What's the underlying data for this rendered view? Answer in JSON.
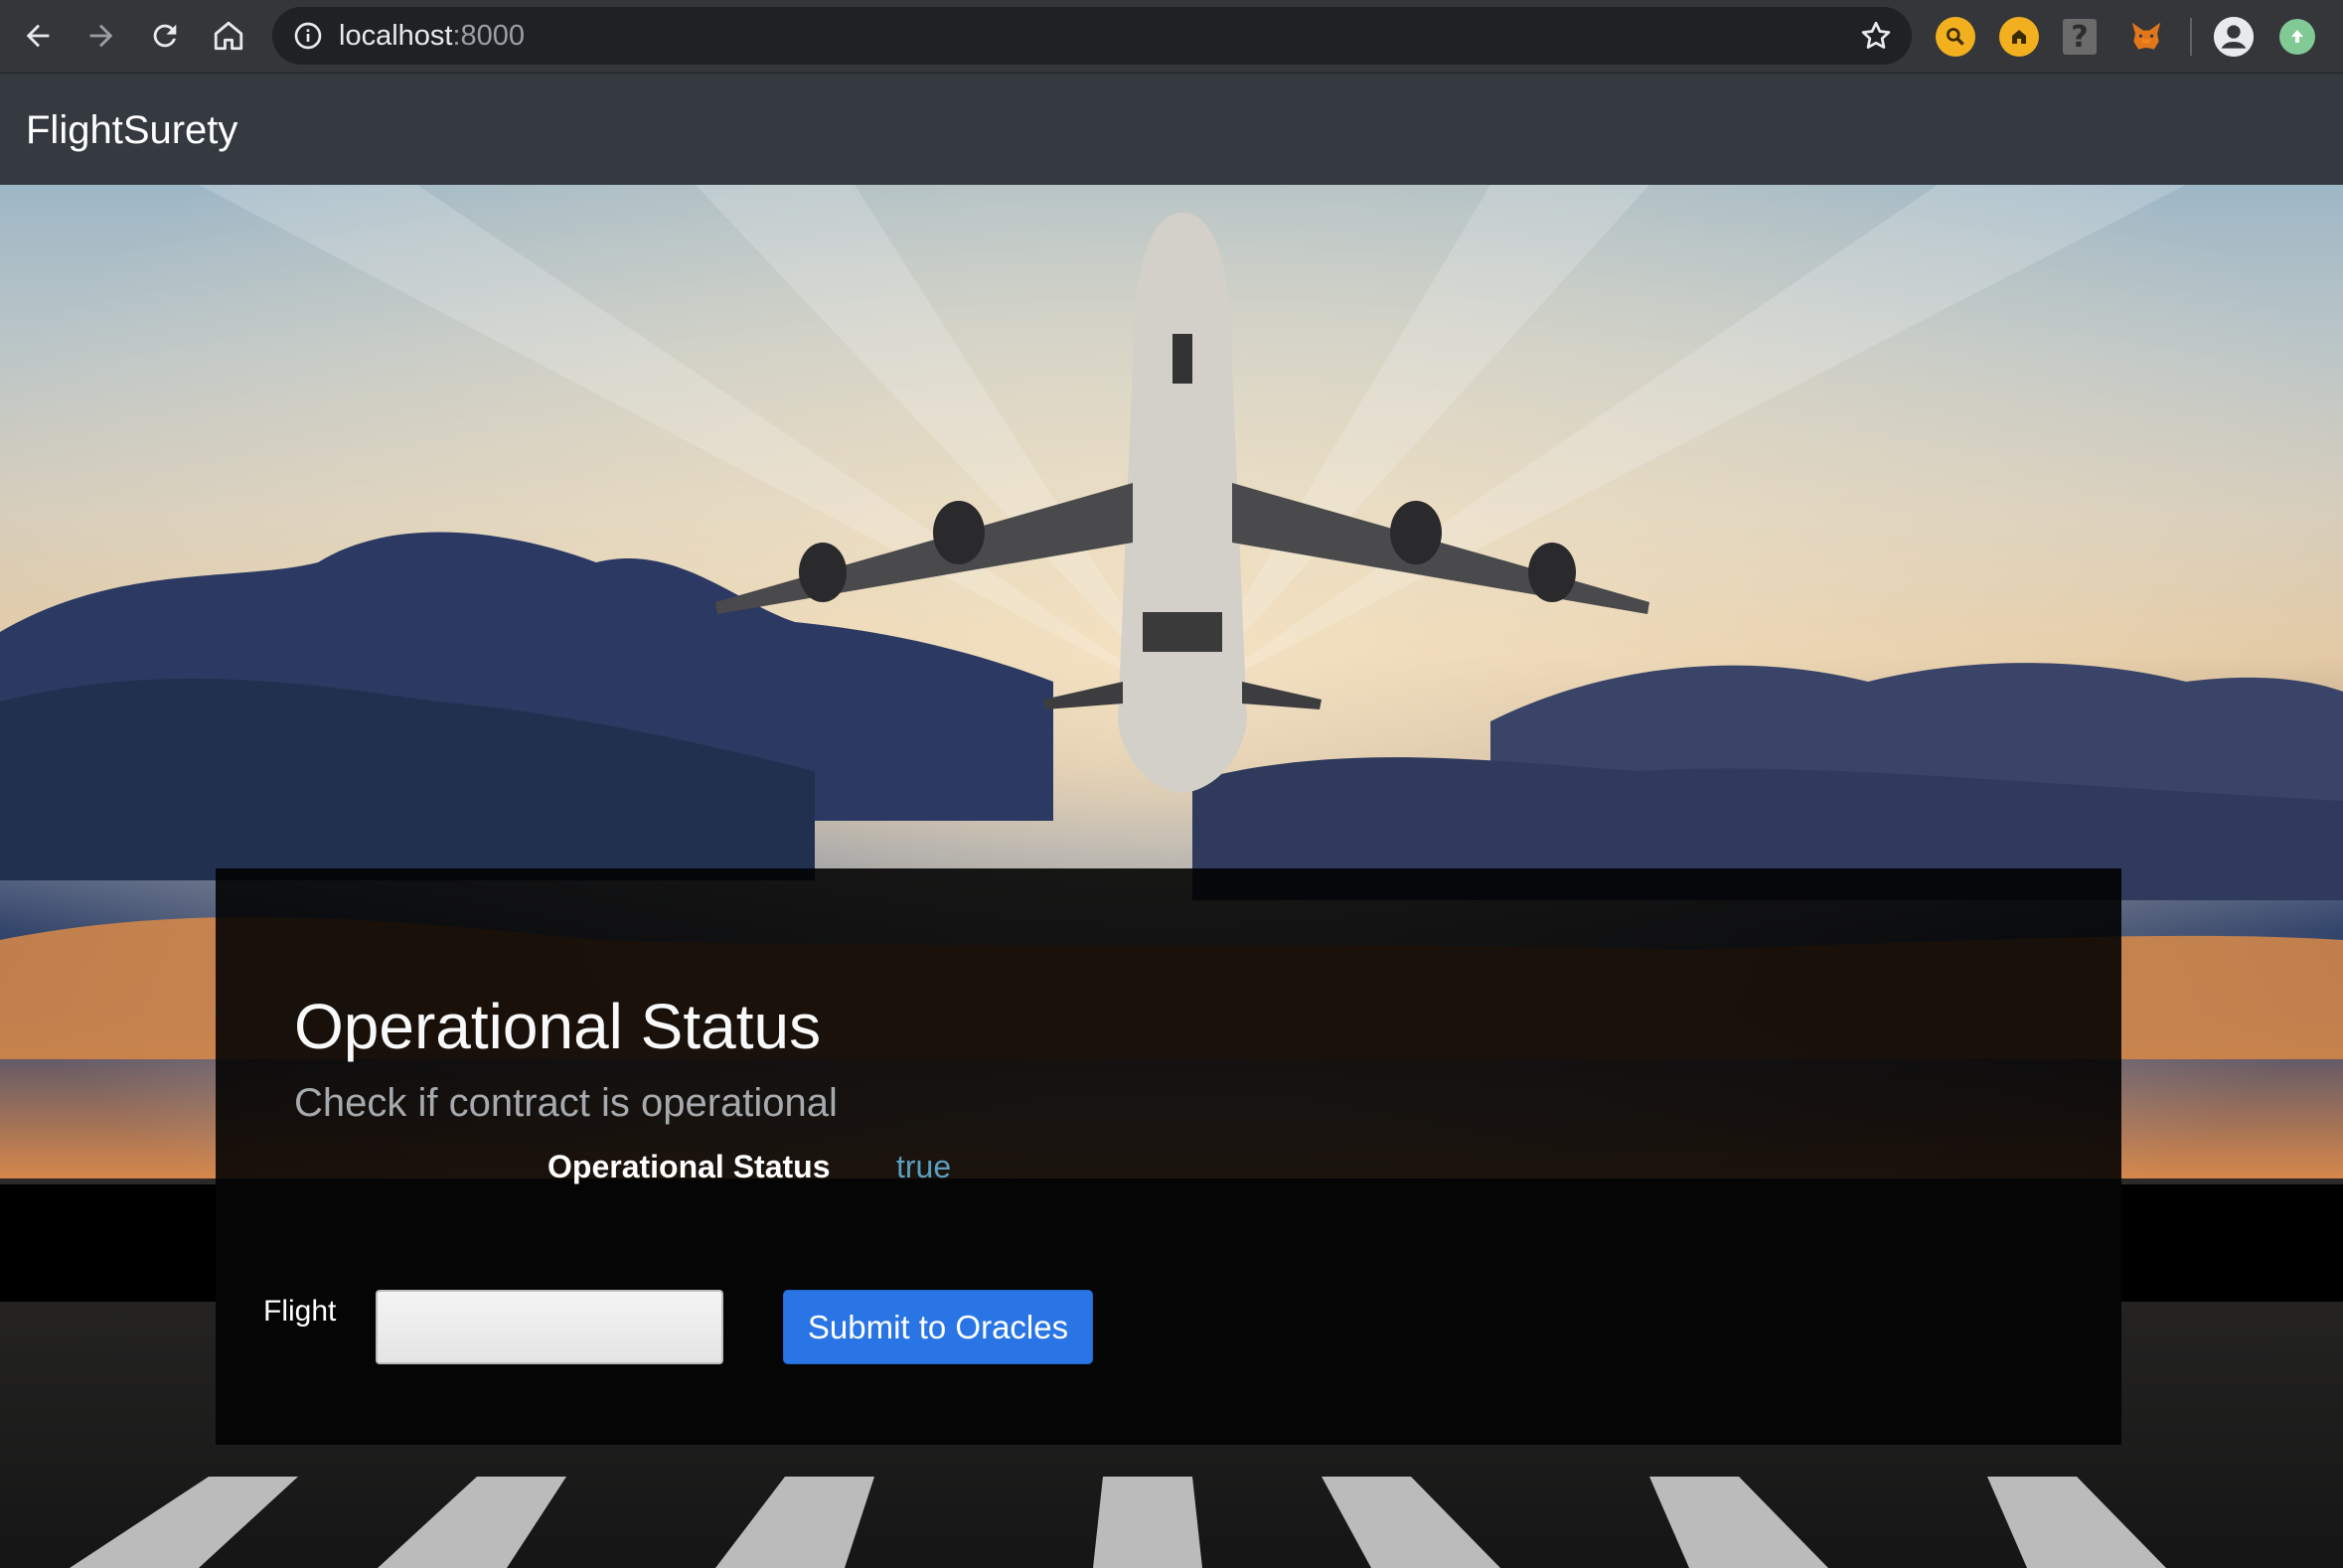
{
  "browser": {
    "url_host": "localhost",
    "url_port": ":8000",
    "icons": {
      "back": "arrow-left-icon",
      "forward": "arrow-right-icon",
      "reload": "reload-icon",
      "home": "home-icon",
      "info": "info-icon",
      "bookmark": "star-icon",
      "profile": "account-icon"
    },
    "extensions": [
      "magnifier-extension-icon",
      "home-extension-icon",
      "unknown-extension-icon",
      "metamask-fox-icon",
      "update-icon"
    ]
  },
  "navbar": {
    "brand": "FlightSurety"
  },
  "status": {
    "title": "Operational Status",
    "subtitle": "Check if contract is operational",
    "label": "Operational Status",
    "value": "true"
  },
  "form": {
    "flight_label": "Flight",
    "flight_value": "",
    "submit_label": "Submit to Oracles"
  },
  "colors": {
    "navbar_bg": "#343a40",
    "chrome_bg": "#35363a",
    "button_primary": "#2a75e6",
    "status_value": "#5a9ec0"
  }
}
